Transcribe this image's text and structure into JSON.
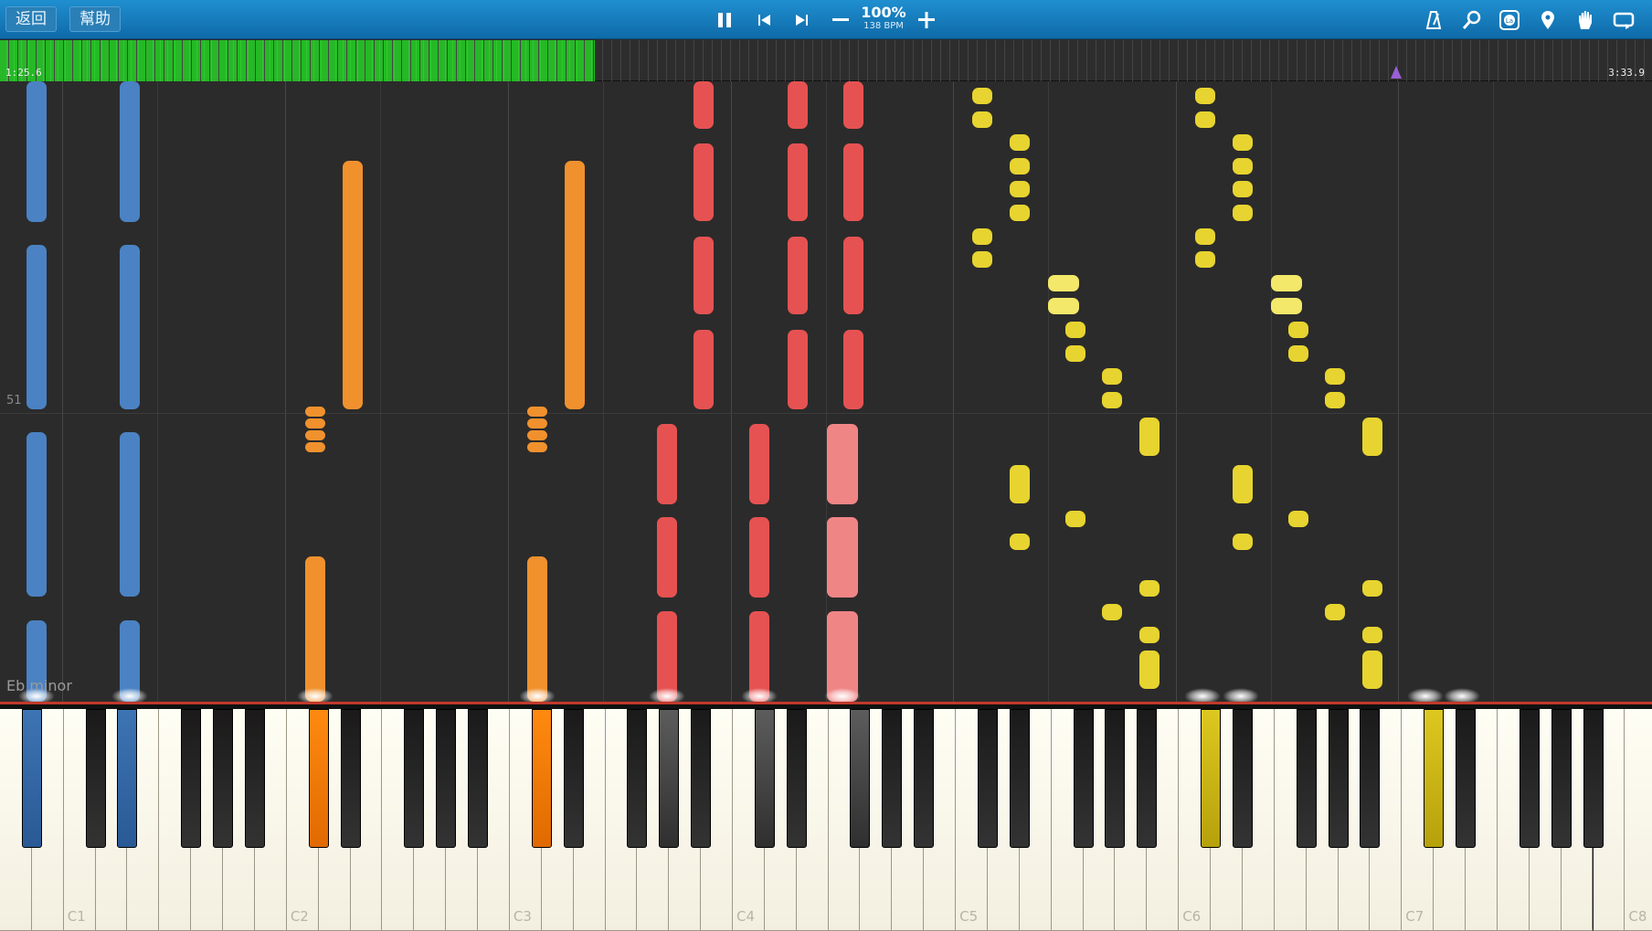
{
  "toolbar": {
    "back_label": "返回",
    "help_label": "幫助",
    "speed_percent": "100%",
    "bpm": "138 BPM",
    "icons": [
      "pause-icon",
      "skip-back-icon",
      "skip-forward-icon",
      "minus-icon",
      "plus-icon",
      "metronome-icon",
      "magnifier-icon",
      "note-label-icon",
      "location-pin-icon",
      "hand-icon",
      "loop-icon"
    ]
  },
  "timeline": {
    "current_time": "1:25.6",
    "total_time": "3:33.9",
    "progress_fraction": 0.4
  },
  "roll": {
    "measure_number": "51",
    "key_signature": "Eb minor"
  },
  "keyboard": {
    "octave_labels": [
      "C1",
      "C2",
      "C3",
      "C4",
      "C5",
      "C6",
      "C7",
      "C8"
    ],
    "track_colors": {
      "left_hand_low": "#4b82c3",
      "left_hand": "#f0912e",
      "middle": "#e65252",
      "right_hand": "#e7d430"
    }
  }
}
